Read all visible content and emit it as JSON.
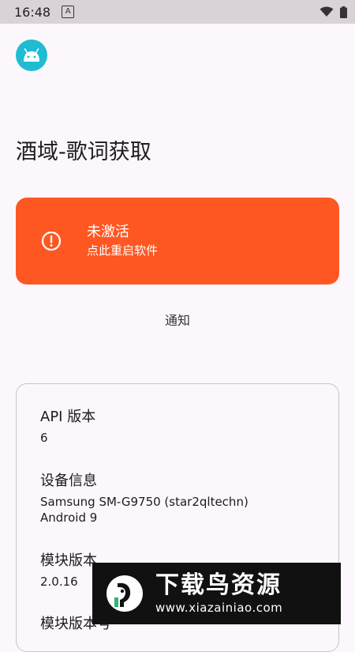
{
  "status_bar": {
    "time": "16:48",
    "notification_glyph": "A"
  },
  "app": {
    "title": "酒域-歌词获取",
    "icon": "android-icon"
  },
  "activation_card": {
    "title": "未激活",
    "subtitle": "点此重启软件",
    "color": "#FF5722"
  },
  "notify_link": "通知",
  "info": {
    "items": [
      {
        "label": "API 版本",
        "value": "6"
      },
      {
        "label": "设备信息",
        "value_line1": "Samsung SM-G9750 (star2qltechn)",
        "value_line2": "Android 9"
      },
      {
        "label": "模块版本",
        "value": "2.0.16"
      },
      {
        "label": "模块版本号"
      }
    ]
  },
  "watermark": {
    "title": "下载鸟资源",
    "url": "www.xiazainiao.com"
  }
}
